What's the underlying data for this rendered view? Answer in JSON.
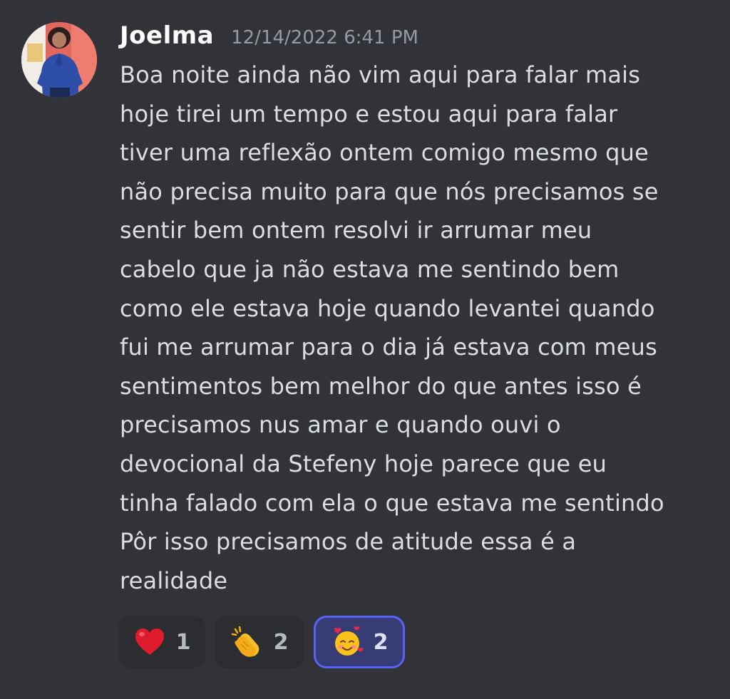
{
  "message": {
    "author": "Joelma",
    "timestamp": "12/14/2022 6:41 PM",
    "lines": [
      "Boa noite ainda não vim aqui para falar mais",
      "hoje tirei um tempo e estou aqui para falar",
      "tiver uma reflexão ontem comigo mesmo que",
      "não precisa muito para que nós precisamos se",
      "sentir bem ontem resolvi ir arrumar meu",
      "cabelo que ja não estava me sentindo bem",
      "como ele estava hoje quando levantei quando",
      "fui me arrumar para o dia já estava com meus",
      "sentimentos bem melhor do que antes isso é",
      "precisamos nus amar e quando ouvi o",
      "devocional da Stefeny hoje parece que eu",
      "tinha falado com ela o que estava me sentindo",
      "Pôr isso precisamos de atitude essa é a",
      "realidade"
    ]
  },
  "reactions": [
    {
      "emoji": "heart-emoji",
      "count": "1",
      "selected": false
    },
    {
      "emoji": "clapping-hands-emoji",
      "count": "2",
      "selected": false
    },
    {
      "emoji": "smiling-face-with-hearts-emoji",
      "count": "2",
      "selected": true
    }
  ],
  "colors": {
    "background": "#313338",
    "reaction_bg": "#2b2d31",
    "reaction_selected_bg": "#383c74",
    "reaction_selected_border": "#5865f2"
  }
}
